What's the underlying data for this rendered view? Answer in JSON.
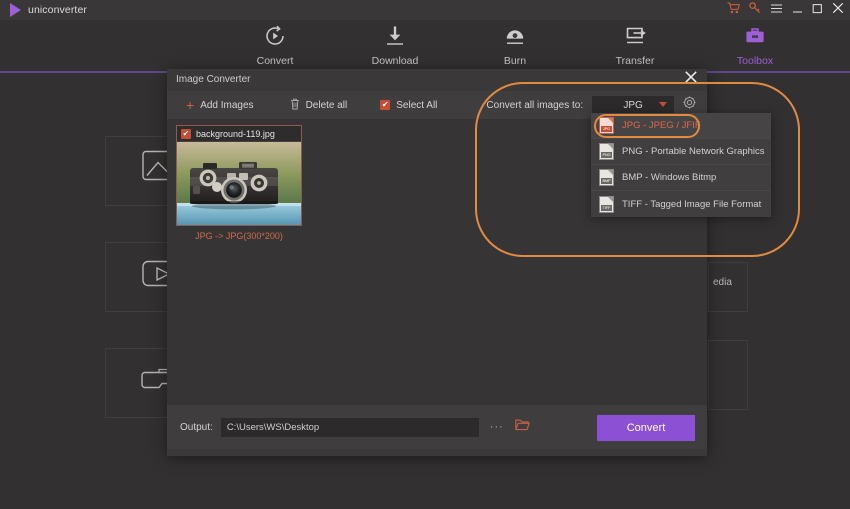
{
  "app": {
    "brand": "uniconverter",
    "logo_icon": "play-triangle-icon",
    "accent_purple": "#9e5fd6",
    "accent_orange": "#d4603e",
    "annotation_color": "#e08a42"
  },
  "window_controls": [
    {
      "name": "cart-icon",
      "glyph": "🛒"
    },
    {
      "name": "key-icon",
      "glyph": "🔑"
    },
    {
      "name": "menu-icon",
      "glyph": "≡"
    },
    {
      "name": "minimize-icon",
      "glyph": "＿"
    },
    {
      "name": "maximize-icon",
      "glyph": "□"
    },
    {
      "name": "close-icon",
      "glyph": "✕"
    }
  ],
  "nav": {
    "items": [
      {
        "label": "Convert",
        "icon": "convert-icon",
        "active": false
      },
      {
        "label": "Download",
        "icon": "download-icon",
        "active": false
      },
      {
        "label": "Burn",
        "icon": "burn-icon",
        "active": false
      },
      {
        "label": "Transfer",
        "icon": "transfer-icon",
        "active": false
      },
      {
        "label": "Toolbox",
        "icon": "toolbox-icon",
        "active": true
      }
    ]
  },
  "background_cards": [
    {
      "icon": "image-converter-icon",
      "label": ""
    },
    {
      "icon": "video-metadata-icon",
      "label": ""
    },
    {
      "icon": "vr-converter-icon",
      "label": ""
    },
    {
      "icon": "",
      "label": "edia"
    }
  ],
  "dialog": {
    "title": "Image Converter",
    "close_label": "✕",
    "toolbar": {
      "add_images": "Add Images",
      "add_icon": "plus-icon",
      "delete_all": "Delete all",
      "delete_icon": "trash-icon",
      "select_all": "Select All",
      "select_all_checked": true,
      "convert_to_label": "Convert all images to:",
      "format_value": "JPG",
      "settings_icon": "gear-icon"
    },
    "dropdown": {
      "open": true,
      "options": [
        {
          "tag": "JPG",
          "label": "JPG - JPEG / JFIF",
          "selected": true
        },
        {
          "tag": "PNG",
          "label": "PNG - Portable Network Graphics",
          "selected": false
        },
        {
          "tag": "BMP",
          "label": "BMP - Windows Bitmp",
          "selected": false
        },
        {
          "tag": "TIFF",
          "label": "TIFF - Tagged Image File Format",
          "selected": false
        }
      ]
    },
    "files": [
      {
        "name": "background-119.jpg",
        "checked": true,
        "conversion": "JPG -> JPG(300*200)",
        "thumbnail_alt": "vintage-camera-photo"
      }
    ],
    "output": {
      "label": "Output:",
      "path": "C:\\Users\\WS\\Desktop",
      "placeholder": "C:\\Users\\WS\\Desktop",
      "browse_dots": "···",
      "folder_icon": "folder-icon",
      "convert_button": "Convert"
    }
  }
}
